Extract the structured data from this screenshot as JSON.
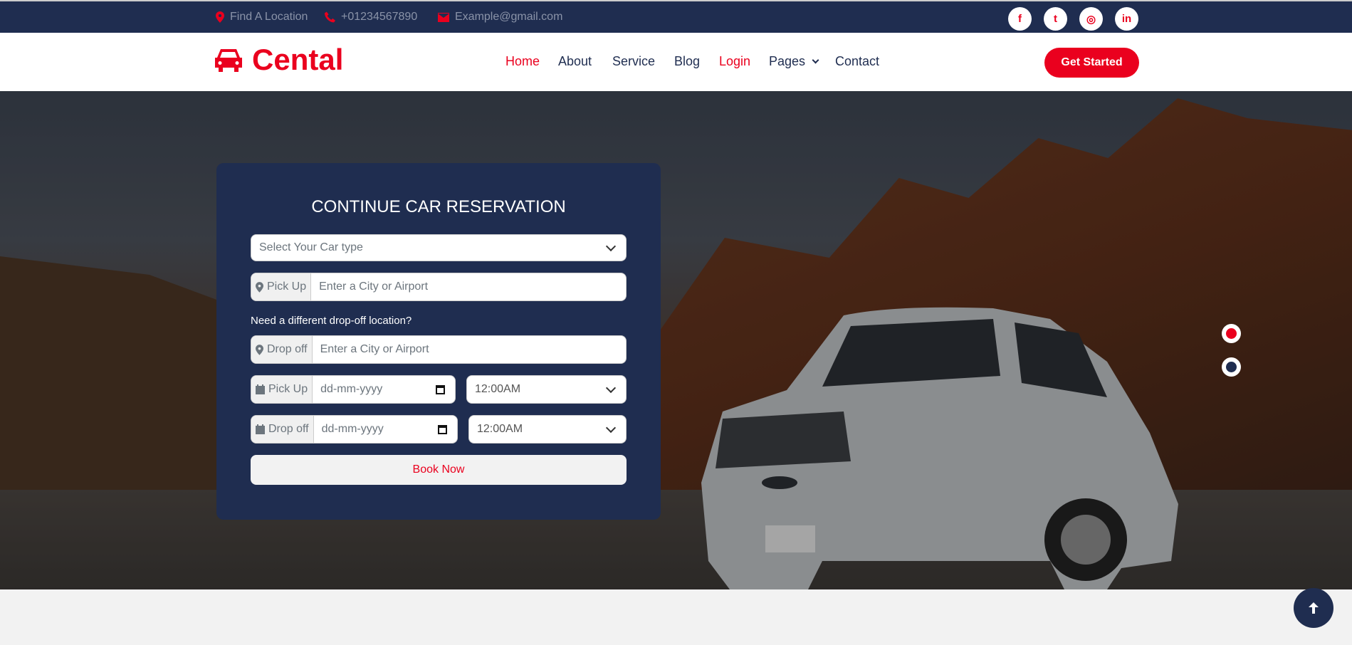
{
  "topbar": {
    "location": "Find A Location",
    "phone": "+01234567890",
    "email": "Example@gmail.com",
    "social": [
      {
        "icon": "facebook-icon",
        "glyph": "f"
      },
      {
        "icon": "twitter-icon",
        "glyph": "t"
      },
      {
        "icon": "instagram-icon",
        "glyph": "◎"
      },
      {
        "icon": "linkedin-icon",
        "glyph": "in"
      }
    ]
  },
  "nav": {
    "brand": "Cental",
    "items": [
      "Home",
      "About",
      "Service",
      "Blog",
      "Login",
      "Pages",
      "Contact"
    ],
    "cta": "Get Started"
  },
  "form": {
    "title": "CONTINUE CAR RESERVATION",
    "car_type_placeholder": "Select Your Car type",
    "pickup_label": "Pick Up",
    "pickup_placeholder": "Enter a City or Airport",
    "dropoff_question": "Need a different drop-off location?",
    "dropoff_label": "Drop off",
    "dropoff_placeholder": "Enter a City or Airport",
    "pickup_date_label": "Pick Up",
    "pickup_date": "dd-mm-yyyy",
    "pickup_time": "12:00AM",
    "dropoff_date_label": "Drop off",
    "dropoff_date": "dd-mm-yyyy",
    "dropoff_time": "12:00AM",
    "book": "Book Now"
  },
  "colors": {
    "accent": "#ea001e",
    "navy": "#1f2d50"
  }
}
